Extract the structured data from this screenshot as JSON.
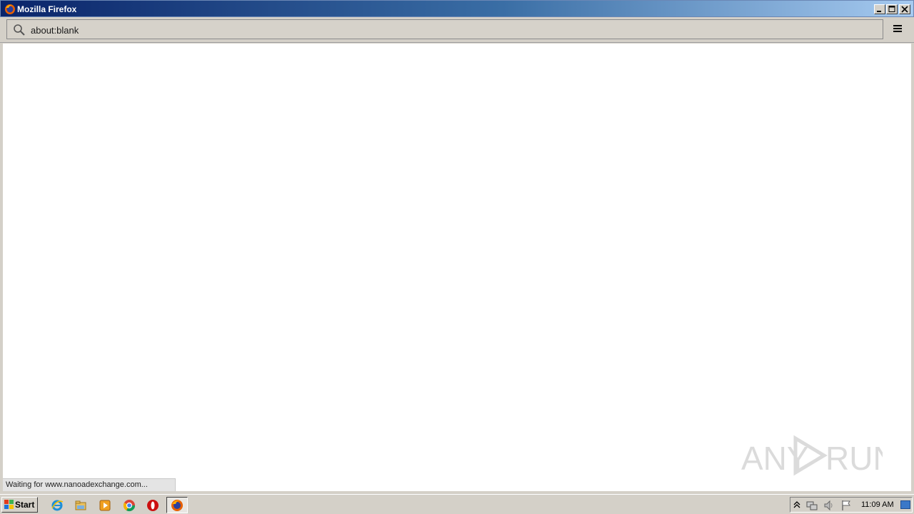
{
  "window": {
    "title": "Mozilla Firefox"
  },
  "toolbar": {
    "url": "about:blank"
  },
  "status": {
    "text": "Waiting for www.nanoadexchange.com..."
  },
  "watermark": {
    "text": "ANY RUN"
  },
  "taskbar": {
    "start_label": "Start",
    "apps": [
      "internet-explorer",
      "file-explorer",
      "media-player",
      "chrome",
      "opera",
      "firefox"
    ],
    "clock": "11:09 AM"
  },
  "colors": {
    "titlebar_start": "#0a246a",
    "titlebar_end": "#a6caf0",
    "chrome": "#d4d0c8"
  }
}
